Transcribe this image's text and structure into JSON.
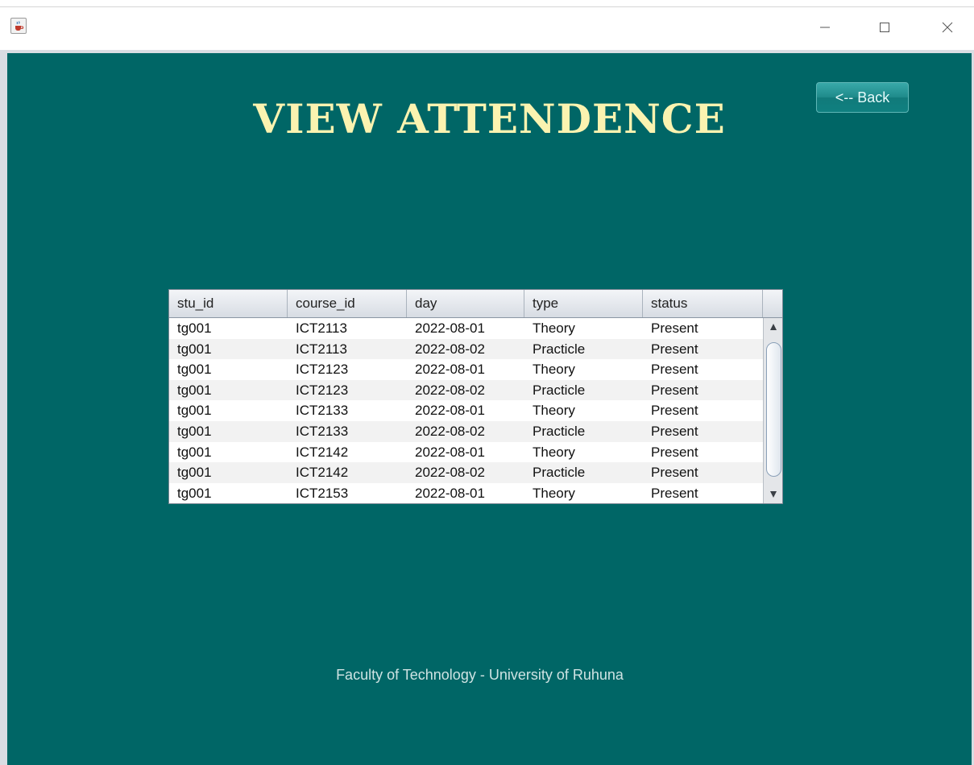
{
  "window": {
    "icon": "java-cup-icon",
    "minimize_icon": "minimize-icon",
    "maximize_icon": "maximize-icon",
    "close_icon": "close-icon"
  },
  "page": {
    "title": "VIEW ATTENDENCE",
    "back_label": "<-- Back",
    "footer": "Faculty of Technology - University of Ruhuna"
  },
  "colors": {
    "background": "#006666",
    "title": "#fbf3b0",
    "button": "#1e8a8a"
  },
  "table": {
    "columns": [
      "stu_id",
      "course_id",
      "day",
      "type",
      "status"
    ],
    "rows": [
      [
        "tg001",
        "ICT2113",
        "2022-08-01",
        "Theory",
        "Present"
      ],
      [
        "tg001",
        "ICT2113",
        "2022-08-02",
        "Practicle",
        "Present"
      ],
      [
        "tg001",
        "ICT2123",
        "2022-08-01",
        "Theory",
        "Present"
      ],
      [
        "tg001",
        "ICT2123",
        "2022-08-02",
        "Practicle",
        "Present"
      ],
      [
        "tg001",
        "ICT2133",
        "2022-08-01",
        "Theory",
        "Present"
      ],
      [
        "tg001",
        "ICT2133",
        "2022-08-02",
        "Practicle",
        "Present"
      ],
      [
        "tg001",
        "ICT2142",
        "2022-08-01",
        "Theory",
        "Present"
      ],
      [
        "tg001",
        "ICT2142",
        "2022-08-02",
        "Practicle",
        "Present"
      ],
      [
        "tg001",
        "ICT2153",
        "2022-08-01",
        "Theory",
        "Present"
      ]
    ]
  }
}
